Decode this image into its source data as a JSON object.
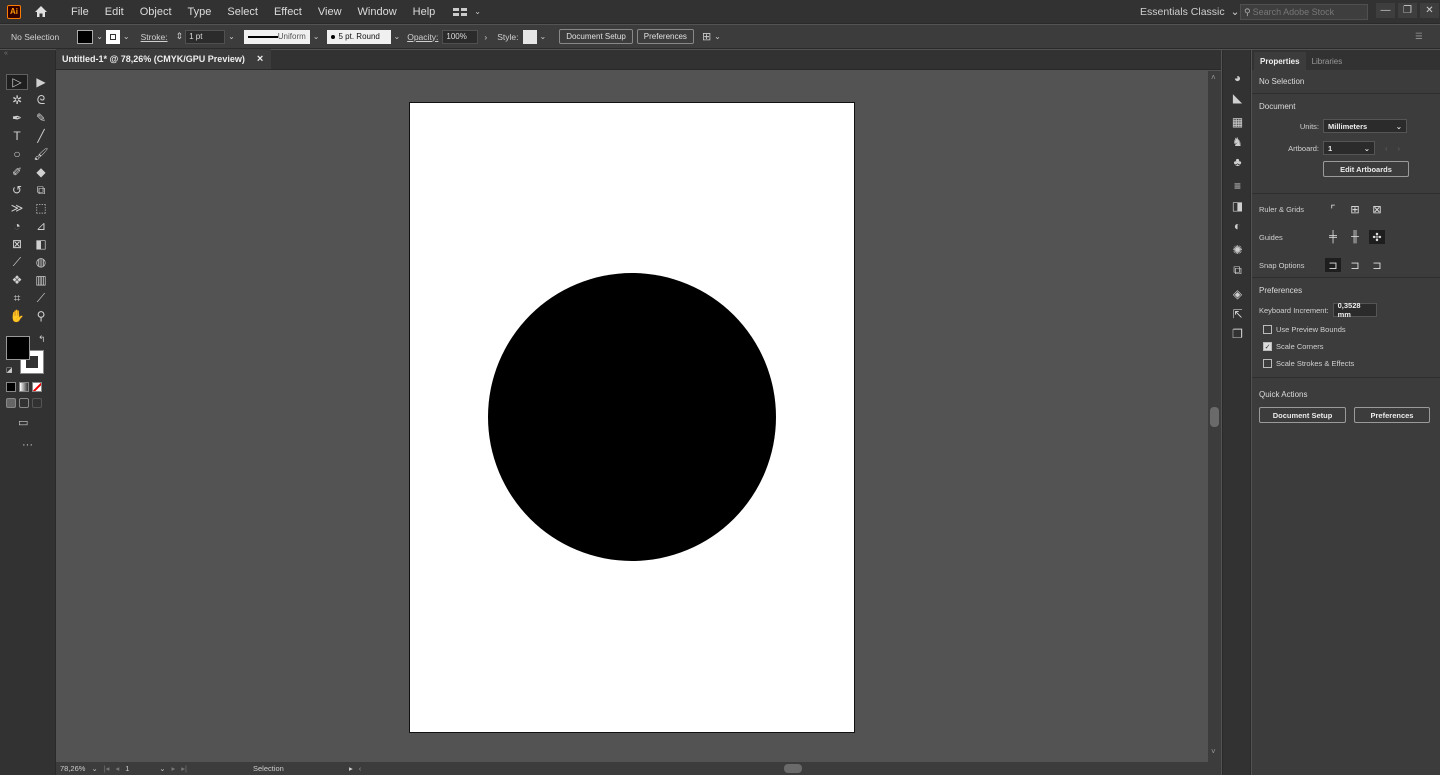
{
  "menubar": {
    "app_logo": "Ai",
    "items": [
      "File",
      "Edit",
      "Object",
      "Type",
      "Select",
      "Effect",
      "View",
      "Window",
      "Help"
    ],
    "workspace": "Essentials Classic",
    "search_placeholder": "Search Adobe Stock"
  },
  "control": {
    "selection": "No Selection",
    "stroke_label": "Stroke:",
    "stroke_weight": "1 pt",
    "stroke_profile": "Uniform",
    "brush": "5 pt. Round",
    "opacity_label": "Opacity:",
    "opacity": "100%",
    "style_label": "Style:",
    "document_setup": "Document Setup",
    "preferences": "Preferences"
  },
  "document": {
    "tab_title": "Untitled-1* @ 78,26% (CMYK/GPU Preview)",
    "close": "×",
    "zoom": "78,26%",
    "artboard_number": "1",
    "status": "Selection"
  },
  "panel": {
    "tabs": [
      "Properties",
      "Libraries"
    ],
    "selection": "No Selection",
    "document_title": "Document",
    "units_label": "Units:",
    "units_value": "Millimeters",
    "artboard_label": "Artboard:",
    "artboard_value": "1",
    "edit_artboards": "Edit Artboards",
    "ruler_grids": "Ruler & Grids",
    "guides": "Guides",
    "snap_options": "Snap Options",
    "preferences_title": "Preferences",
    "keyboard_increment_label": "Keyboard Increment:",
    "keyboard_increment_value": "0,3528 mm",
    "use_preview_bounds": "Use Preview Bounds",
    "scale_corners": "Scale Corners",
    "scale_strokes": "Scale Strokes & Effects",
    "quick_actions": "Quick Actions",
    "qa_document_setup": "Document Setup",
    "qa_preferences": "Preferences"
  },
  "colors": {
    "fill": "#000000",
    "stroke": "#ffffff",
    "accent": "#ff7c00"
  }
}
